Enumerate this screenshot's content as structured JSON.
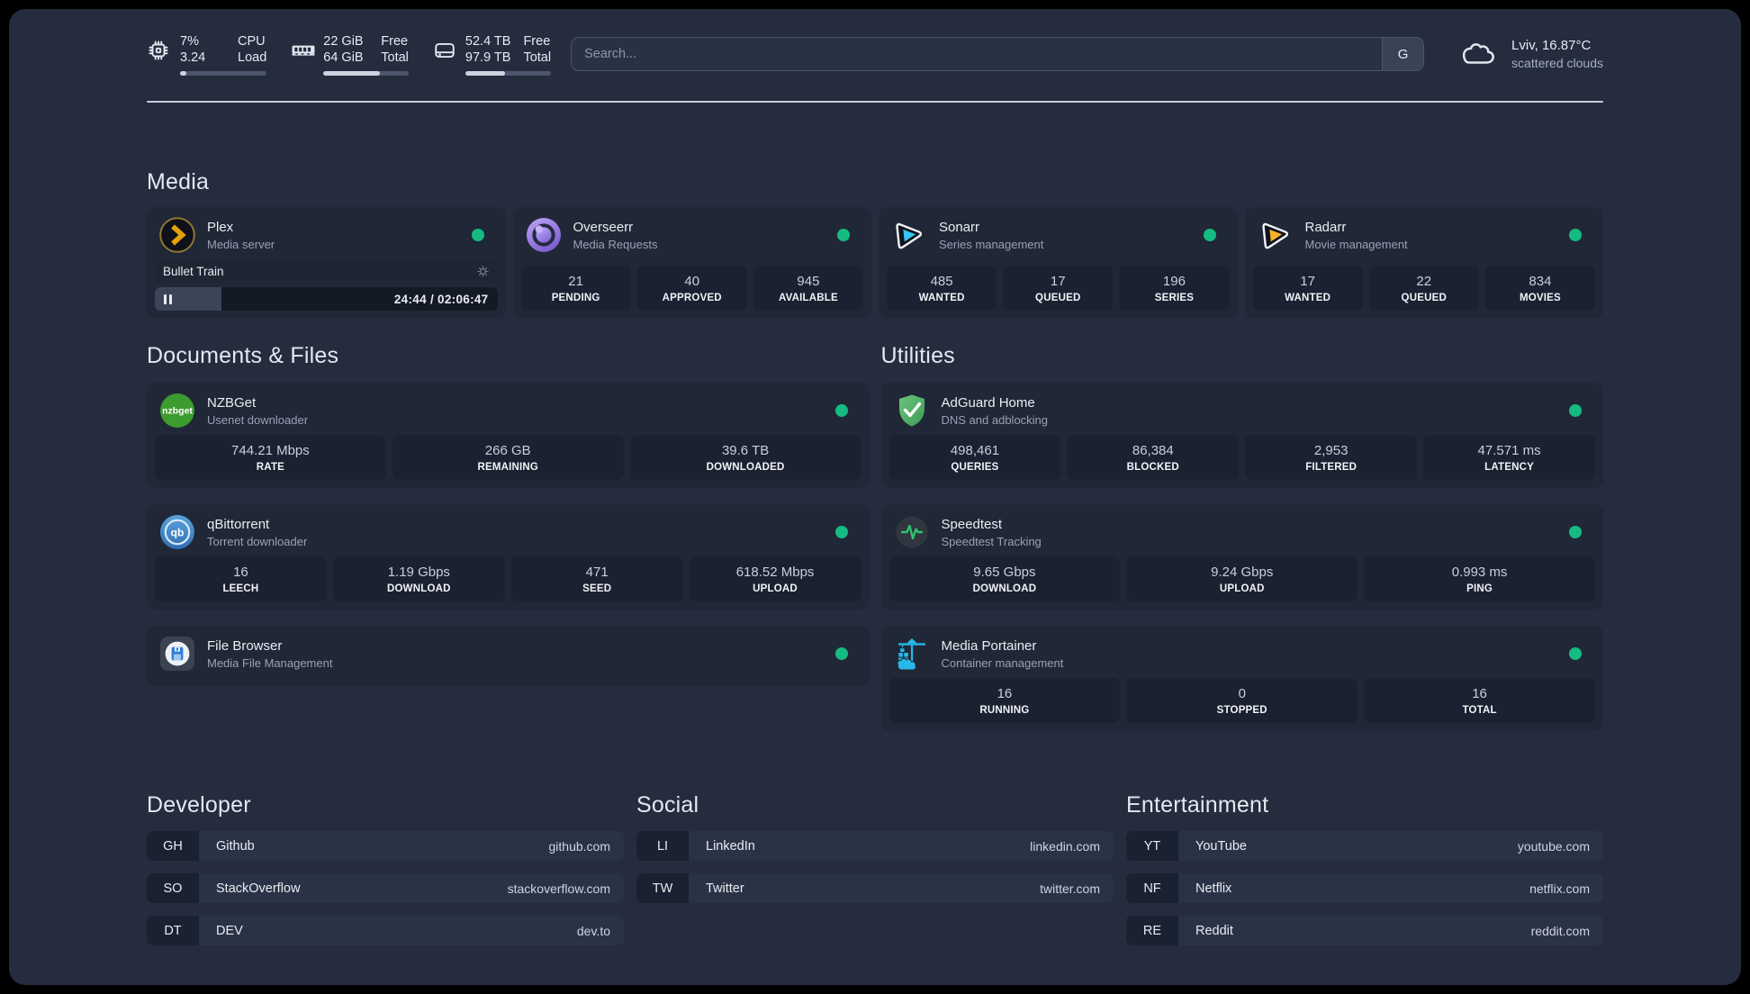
{
  "header": {
    "resources": [
      {
        "id": "cpu",
        "icon": "cpu-icon",
        "values": [
          "7%",
          "3.24"
        ],
        "labels": [
          "CPU",
          "Load"
        ],
        "percent": 7
      },
      {
        "id": "memory",
        "icon": "memory-icon",
        "values": [
          "22 GiB",
          "64 GiB"
        ],
        "labels": [
          "Free",
          "Total"
        ],
        "percent": 66
      },
      {
        "id": "disk",
        "icon": "disk-icon",
        "values": [
          "52.4 TB",
          "97.9 TB"
        ],
        "labels": [
          "Free",
          "Total"
        ],
        "percent": 46
      }
    ],
    "search": {
      "placeholder": "Search...",
      "provider_label": "G"
    },
    "weather": {
      "location": "Lviv, 16.87°C",
      "condition": "scattered clouds"
    }
  },
  "sections": {
    "media": {
      "title": "Media",
      "cards": [
        {
          "id": "plex",
          "icon": "plex-icon",
          "title": "Plex",
          "subtitle": "Media server",
          "status": "online",
          "player": {
            "title": "Bullet Train",
            "time": "24:44 / 02:06:47",
            "progress_percent": 19.5
          }
        },
        {
          "id": "overseerr",
          "icon": "overseerr-icon",
          "title": "Overseerr",
          "subtitle": "Media Requests",
          "status": "online",
          "stats": [
            {
              "value": "21",
              "label": "PENDING"
            },
            {
              "value": "40",
              "label": "APPROVED"
            },
            {
              "value": "945",
              "label": "AVAILABLE"
            }
          ]
        },
        {
          "id": "sonarr",
          "icon": "sonarr-icon",
          "title": "Sonarr",
          "subtitle": "Series management",
          "status": "online",
          "stats": [
            {
              "value": "485",
              "label": "WANTED"
            },
            {
              "value": "17",
              "label": "QUEUED"
            },
            {
              "value": "196",
              "label": "SERIES"
            }
          ]
        },
        {
          "id": "radarr",
          "icon": "radarr-icon",
          "title": "Radarr",
          "subtitle": "Movie management",
          "status": "online",
          "stats": [
            {
              "value": "17",
              "label": "WANTED"
            },
            {
              "value": "22",
              "label": "QUEUED"
            },
            {
              "value": "834",
              "label": "MOVIES"
            }
          ]
        }
      ]
    },
    "documents": {
      "title": "Documents & Files",
      "cards": [
        {
          "id": "nzbget",
          "icon": "nzbget-icon",
          "title": "NZBGet",
          "subtitle": "Usenet downloader",
          "status": "online",
          "stats": [
            {
              "value": "744.21 Mbps",
              "label": "RATE"
            },
            {
              "value": "266 GB",
              "label": "REMAINING"
            },
            {
              "value": "39.6 TB",
              "label": "DOWNLOADED"
            }
          ]
        },
        {
          "id": "qbittorrent",
          "icon": "qbittorrent-icon",
          "title": "qBittorrent",
          "subtitle": "Torrent downloader",
          "status": "online",
          "stats": [
            {
              "value": "16",
              "label": "LEECH"
            },
            {
              "value": "1.19 Gbps",
              "label": "DOWNLOAD"
            },
            {
              "value": "471",
              "label": "SEED"
            },
            {
              "value": "618.52 Mbps",
              "label": "UPLOAD"
            }
          ]
        },
        {
          "id": "filebrowser",
          "icon": "filebrowser-icon",
          "title": "File Browser",
          "subtitle": "Media File Management",
          "status": "online"
        }
      ]
    },
    "utilities": {
      "title": "Utilities",
      "cards": [
        {
          "id": "adguard",
          "icon": "adguard-icon",
          "title": "AdGuard Home",
          "subtitle": "DNS and adblocking",
          "status": "online",
          "stats": [
            {
              "value": "498,461",
              "label": "QUERIES"
            },
            {
              "value": "86,384",
              "label": "BLOCKED"
            },
            {
              "value": "2,953",
              "label": "FILTERED"
            },
            {
              "value": "47.571 ms",
              "label": "LATENCY"
            }
          ]
        },
        {
          "id": "speedtest",
          "icon": "speedtest-icon",
          "title": "Speedtest",
          "subtitle": "Speedtest Tracking",
          "status": "online",
          "stats": [
            {
              "value": "9.65 Gbps",
              "label": "DOWNLOAD"
            },
            {
              "value": "9.24 Gbps",
              "label": "UPLOAD"
            },
            {
              "value": "0.993 ms",
              "label": "PING"
            }
          ]
        },
        {
          "id": "portainer",
          "icon": "portainer-icon",
          "title": "Media Portainer",
          "subtitle": "Container management",
          "status": "online",
          "stats": [
            {
              "value": "16",
              "label": "RUNNING"
            },
            {
              "value": "0",
              "label": "STOPPED"
            },
            {
              "value": "16",
              "label": "TOTAL"
            }
          ]
        }
      ]
    }
  },
  "bookmark_groups": [
    {
      "title": "Developer",
      "links": [
        {
          "abbr": "GH",
          "name": "Github",
          "domain": "github.com"
        },
        {
          "abbr": "SO",
          "name": "StackOverflow",
          "domain": "stackoverflow.com"
        },
        {
          "abbr": "DT",
          "name": "DEV",
          "domain": "dev.to"
        }
      ]
    },
    {
      "title": "Social",
      "links": [
        {
          "abbr": "LI",
          "name": "LinkedIn",
          "domain": "linkedin.com"
        },
        {
          "abbr": "TW",
          "name": "Twitter",
          "domain": "twitter.com"
        }
      ]
    },
    {
      "title": "Entertainment",
      "links": [
        {
          "abbr": "YT",
          "name": "YouTube",
          "domain": "youtube.com"
        },
        {
          "abbr": "NF",
          "name": "Netflix",
          "domain": "netflix.com"
        },
        {
          "abbr": "RE",
          "name": "Reddit",
          "domain": "reddit.com"
        }
      ]
    }
  ],
  "colors": {
    "status_online": "#15bb81",
    "accent_green": "#2fc171",
    "portainer_blue": "#27b7e8"
  }
}
